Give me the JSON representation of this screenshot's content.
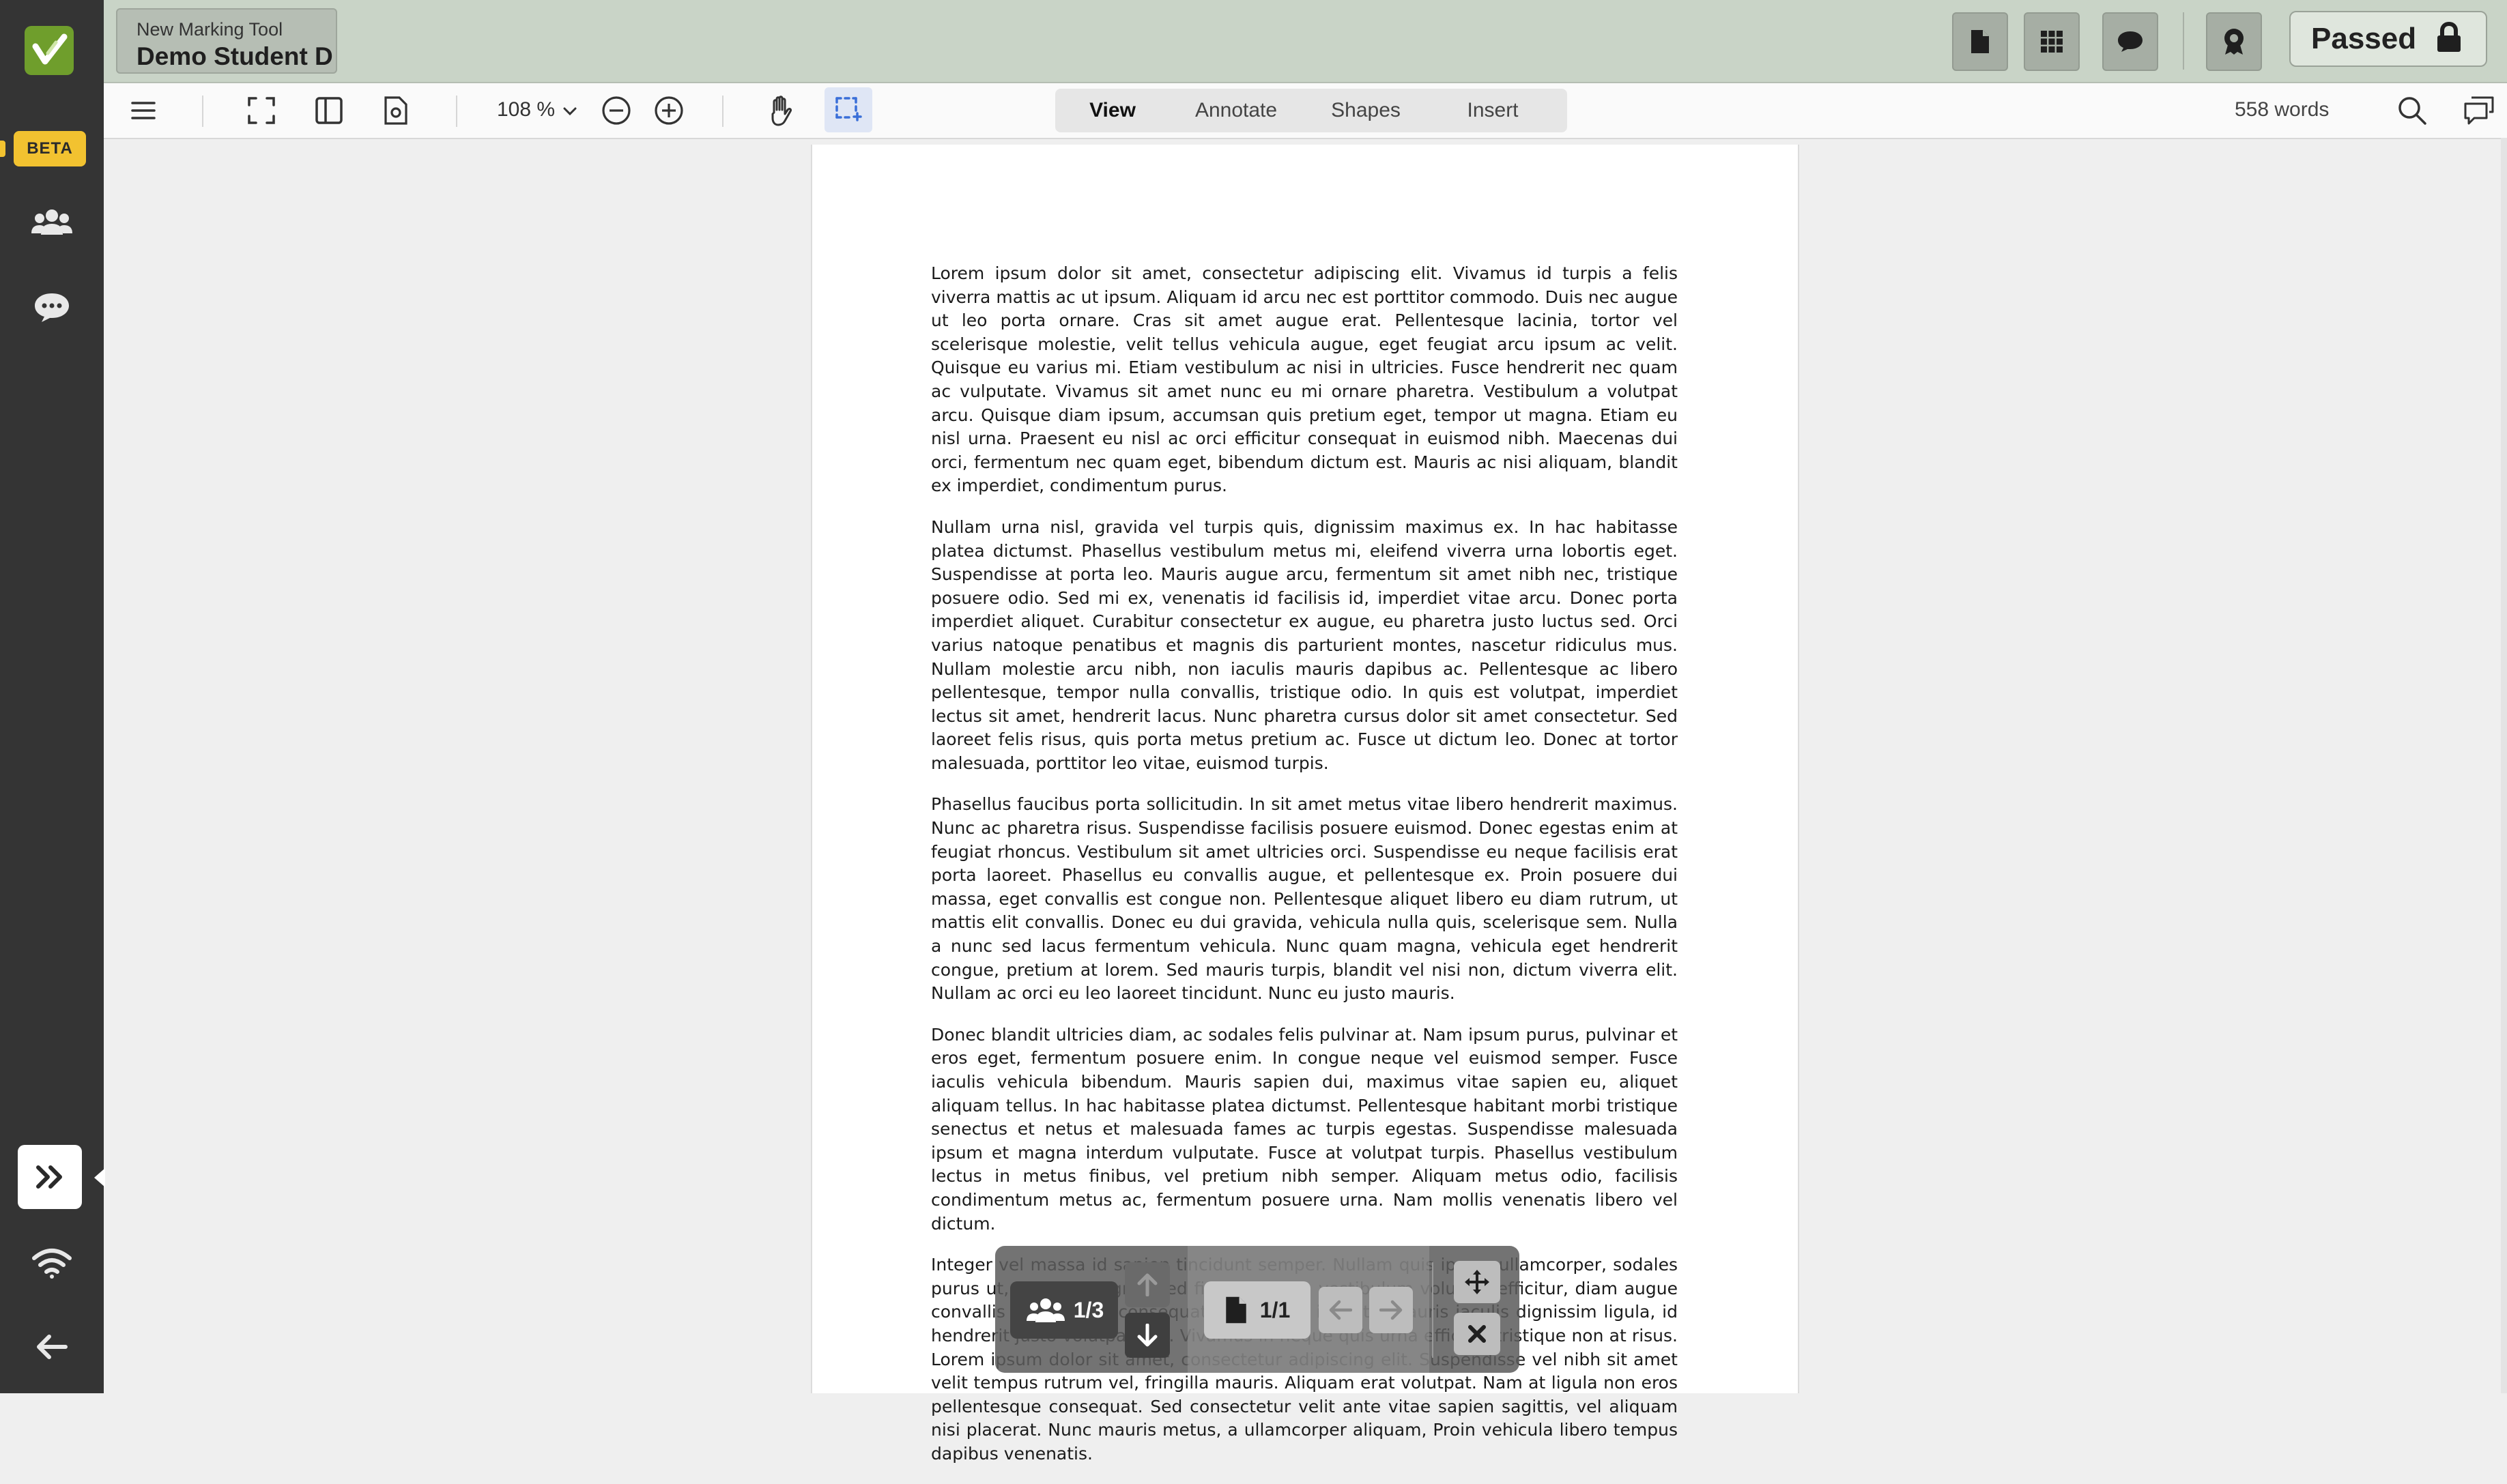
{
  "header": {
    "tool_name": "New Marking Tool",
    "student_name": "Demo Student D",
    "status_label": "Passed"
  },
  "sidebar": {
    "beta_label": "BETA",
    "icons": [
      "logo-icon",
      "users-icon",
      "chat-icon",
      "expand-icon",
      "wifi-icon",
      "back-arrow-icon"
    ]
  },
  "toolbar": {
    "zoom_value": "108 %",
    "tabs": [
      "View",
      "Annotate",
      "Shapes",
      "Insert"
    ],
    "active_tab": "View",
    "word_count": "558 words"
  },
  "document": {
    "paragraphs": [
      "Lorem ipsum dolor sit amet, consectetur adipiscing elit. Vivamus id turpis a felis viverra mattis ac ut ipsum. Aliquam id arcu nec est porttitor commodo. Duis nec augue ut leo porta ornare. Cras sit amet augue erat. Pellentesque lacinia, tortor vel scelerisque molestie, velit tellus vehicula augue, eget feugiat arcu ipsum ac velit. Quisque eu varius mi. Etiam vestibulum ac nisi in ultricies. Fusce hendrerit nec quam ac vulputate. Vivamus sit amet nunc eu mi ornare pharetra. Vestibulum a volutpat arcu. Quisque diam ipsum, accumsan quis pretium eget, tempor ut magna. Etiam eu nisl urna. Praesent eu nisl ac orci efficitur consequat in euismod nibh. Maecenas dui orci, fermentum nec quam eget, bibendum dictum est. Mauris ac nisi aliquam, blandit ex imperdiet, condimentum purus.",
      "Nullam urna nisl, gravida vel turpis quis, dignissim maximus ex. In hac habitasse platea dictumst. Phasellus vestibulum metus mi, eleifend viverra urna lobortis eget. Suspendisse at porta leo. Mauris augue arcu, fermentum sit amet nibh nec, tristique posuere odio. Sed mi ex, venenatis id facilisis id, imperdiet vitae arcu. Donec porta imperdiet aliquet. Curabitur consectetur ex augue, eu pharetra justo luctus sed. Orci varius natoque penatibus et magnis dis parturient montes, nascetur ridiculus mus. Nullam molestie arcu nibh, non iaculis mauris dapibus ac. Pellentesque ac libero pellentesque, tempor nulla convallis, tristique odio. In quis est volutpat, imperdiet lectus sit amet, hendrerit lacus. Nunc pharetra cursus dolor sit amet consectetur. Sed laoreet felis risus, quis porta metus pretium ac. Fusce ut dictum leo. Donec at tortor malesuada, porttitor leo vitae, euismod turpis.",
      "Phasellus faucibus porta sollicitudin. In sit amet metus vitae libero hendrerit maximus. Nunc ac pharetra risus. Suspendisse facilisis posuere euismod. Donec egestas enim at feugiat rhoncus. Vestibulum sit amet ultricies orci. Suspendisse eu neque facilisis erat porta laoreet. Phasellus eu convallis augue, et pellentesque ex. Proin posuere dui massa, eget convallis est congue non. Pellentesque aliquet libero eu diam rutrum, ut mattis elit convallis. Donec eu dui gravida, vehicula nulla quis, scelerisque sem. Nulla a nunc sed lacus fermentum vehicula. Nunc quam magna, vehicula eget hendrerit congue, pretium at lorem. Sed mauris turpis, blandit vel nisi non, dictum viverra elit. Nullam ac orci eu leo laoreet tincidunt. Nunc eu justo mauris.",
      "Donec blandit ultricies diam, ac sodales felis pulvinar at. Nam ipsum purus, pulvinar et eros eget, fermentum posuere enim. In congue neque vel euismod semper. Fusce iaculis vehicula bibendum. Mauris sapien dui, maximus vitae sapien eu, aliquet aliquam tellus. In hac habitasse platea dictumst. Pellentesque habitant morbi tristique senectus et netus et malesuada fames ac turpis egestas. Suspendisse malesuada ipsum et magna interdum vulputate. Fusce at volutpat turpis. Phasellus vestibulum lectus in metus finibus, vel pretium nibh semper. Aliquam metus odio, facilisis condimentum metus ac, fermentum posuere urna. Nam mollis venenatis libero vel dictum.",
      "Integer vel massa id sapien tincidunt semper. Nullam quis ipsum ullamcorper, sodales purus ut, sagittis magna. Sed finibus, lorem vestibulum volutpat efficitur, diam augue convallis massa, non consequat tellus diam id justo. Mauris iaculis dignissim ligula, id hendrerit justo volutpat sed. Vivamus in neque quis urna efficitur tristique non at risus. Lorem ipsum dolor sit amet, consectetur adipiscing elit. Suspendisse vel nibh sit amet velit tempus rutrum vel, fringilla mauris. Aliquam erat volutpat. Nam at ligula non eros pellentesque consequat. Sed consectetur velit ante vitae sapien sagittis, vel aliquam nisi placerat. Nunc mauris metus, a ullamcorper aliquam, Proin vehicula libero tempus dapibus venenatis."
    ]
  },
  "navigator": {
    "student_counter": "1/3",
    "page_counter": "1/1"
  },
  "colors": {
    "rail": "#343434",
    "header": "#c9d4c7",
    "beta": "#f2c230",
    "logo": "#6f9e2c",
    "accent_select": "#3a6fd8"
  }
}
